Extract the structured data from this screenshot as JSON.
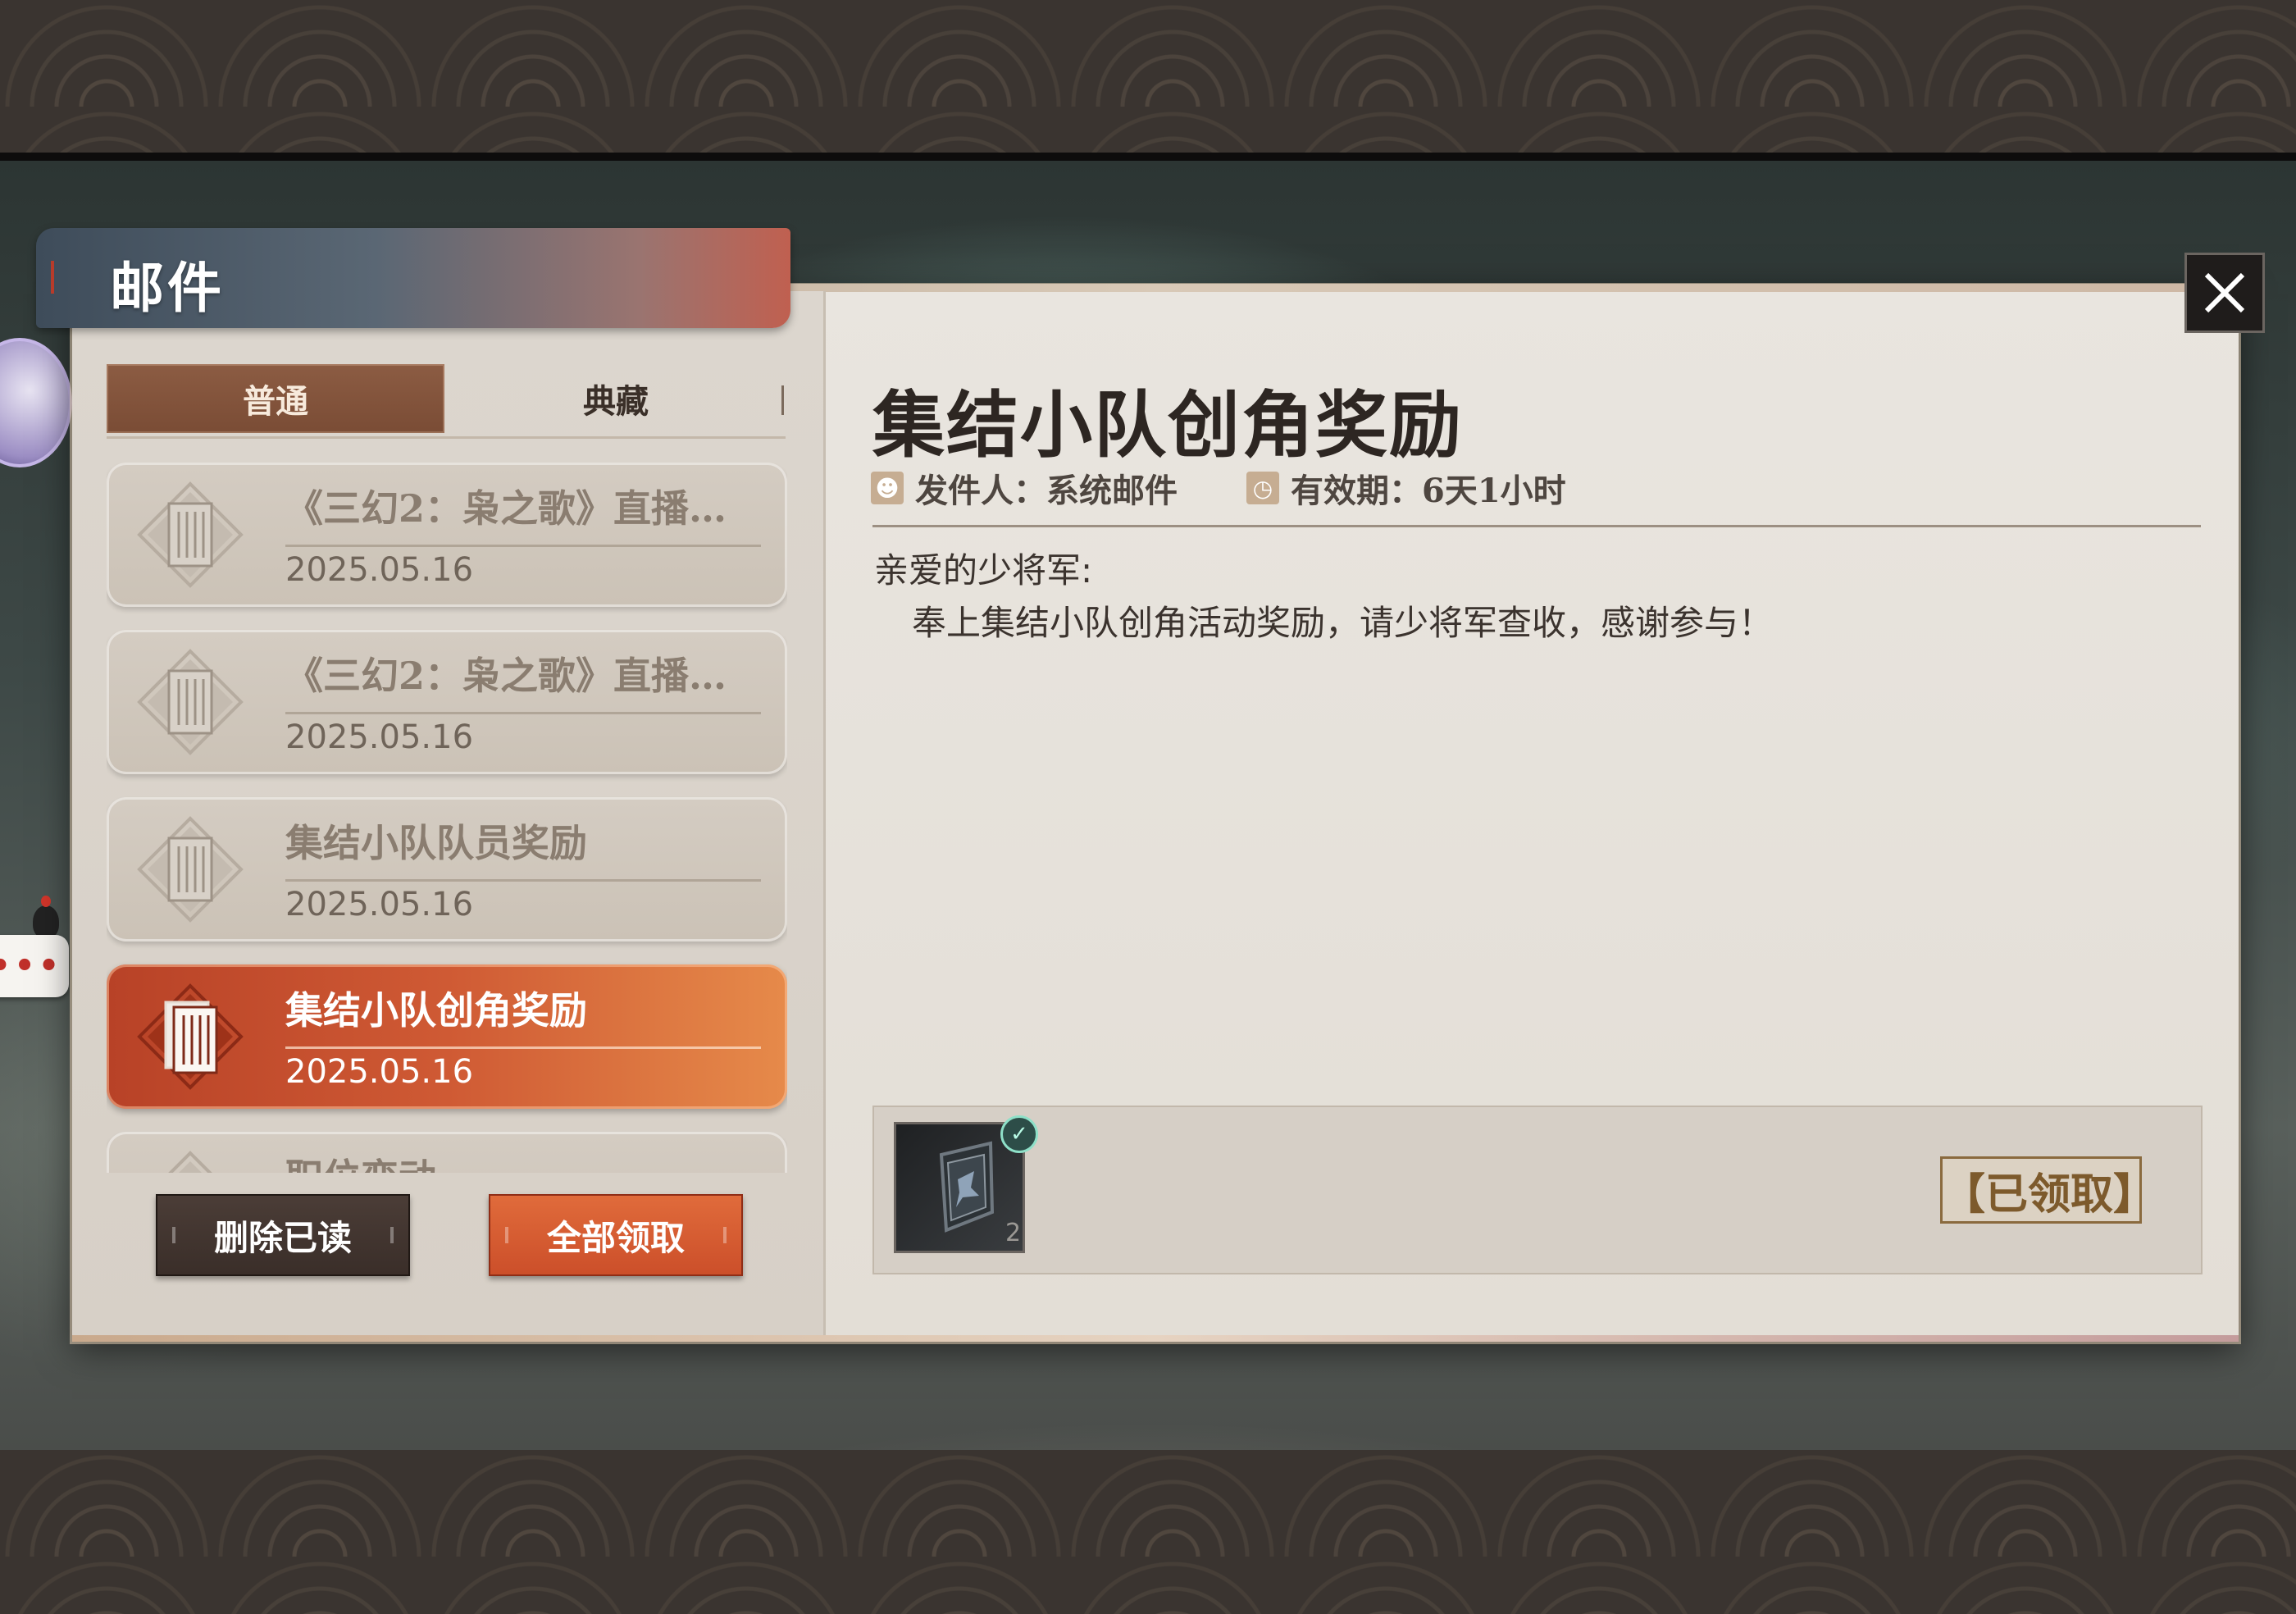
{
  "window": {
    "title": "邮件"
  },
  "tabs": [
    {
      "label": "普通",
      "active": true
    },
    {
      "label": "典藏",
      "active": false
    }
  ],
  "mail_list": [
    {
      "title": "《三幻2：枭之歌》直播…",
      "date": "2025.05.16",
      "selected": false
    },
    {
      "title": "《三幻2：枭之歌》直播…",
      "date": "2025.05.16",
      "selected": false
    },
    {
      "title": "集结小队队员奖励",
      "date": "2025.05.16",
      "selected": false
    },
    {
      "title": "集结小队创角奖励",
      "date": "2025.05.16",
      "selected": true
    },
    {
      "title": "职位变动",
      "date": "",
      "selected": false
    }
  ],
  "buttons": {
    "delete_read": "删除已读",
    "claim_all": "全部领取"
  },
  "detail": {
    "title": "集结小队创角奖励",
    "sender_label": "发件人：系统邮件",
    "expire_label": "有效期：6天1小时",
    "greeting": "亲爱的少将军:",
    "body": "奉上集结小队创角活动奖励，请少将军查收，感谢参与！",
    "reward": {
      "icon": "banner-icon",
      "quantity": "2",
      "claimed": true
    },
    "claimed_label": "【已领取】"
  },
  "icons": {
    "close": "close-icon",
    "sender": "person-icon",
    "expire": "clock-icon",
    "mail": "letter-icon"
  },
  "colors": {
    "accent_orange": "#cf5a34",
    "tab_active": "#7a4c35",
    "panel_bg": "#e6e1da",
    "claimed_brown": "#7d5a2c"
  }
}
